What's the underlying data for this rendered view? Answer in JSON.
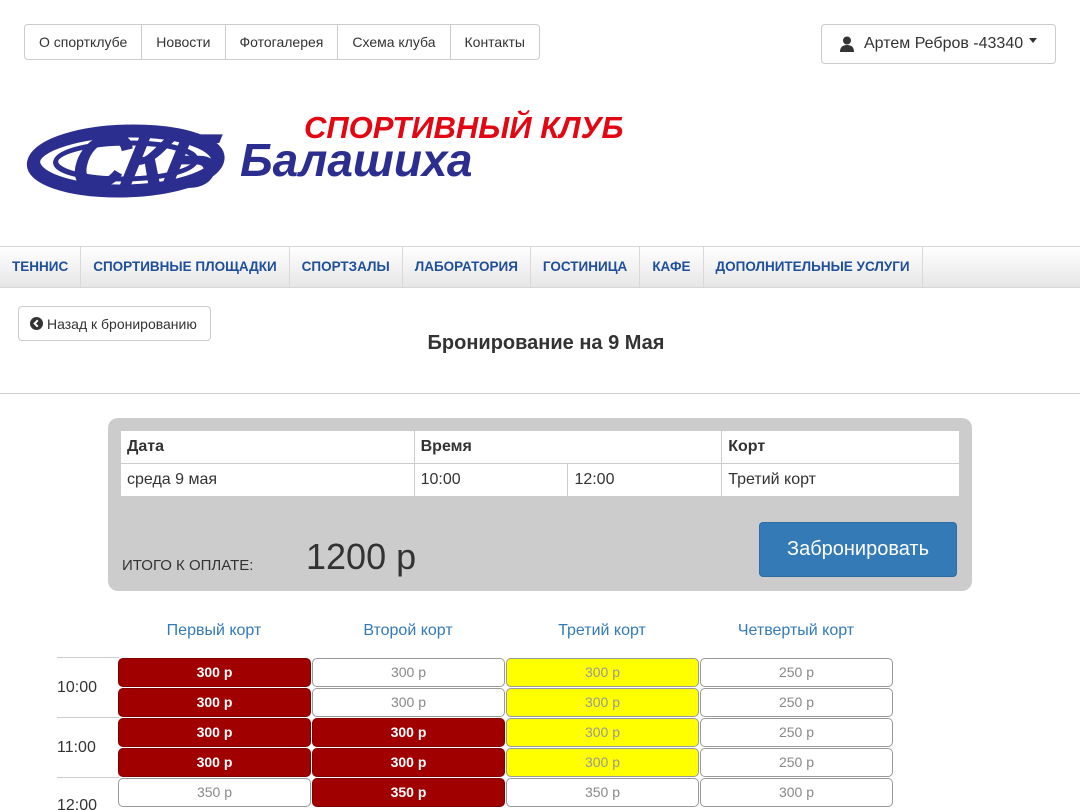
{
  "topnav": [
    "О спортклубе",
    "Новости",
    "Фотогалерея",
    "Схема клуба",
    "Контакты"
  ],
  "user": {
    "name": "Артем Ребров -43340"
  },
  "logo": {
    "line1": "СПОРТИВНЫЙ КЛУБ",
    "line2": "Балашиха",
    "mark": "СКБ"
  },
  "mainnav": [
    "ТЕННИС",
    "СПОРТИВНЫЕ ПЛОЩАДКИ",
    "СПОРТЗАЛЫ",
    "ЛАБОРАТОРИЯ",
    "ГОСТИНИЦА",
    "КАФЕ",
    "ДОПОЛНИТЕЛЬНЫЕ УСЛУГИ"
  ],
  "back_label": "Назад к бронированию",
  "page_title": "Бронирование на 9 Мая",
  "summary": {
    "headers": {
      "date": "Дата",
      "time": "Время",
      "court": "Корт"
    },
    "row": {
      "date": "среда 9 мая",
      "time_from": "10:00",
      "time_to": "12:00",
      "court": "Третий корт"
    },
    "total_label": "ИТОГО К ОПЛАТЕ:",
    "total_value": "1200 р",
    "book_label": "Забронировать"
  },
  "courts": [
    "Первый корт",
    "Второй корт",
    "Третий корт",
    "Четвертый корт"
  ],
  "times": [
    "10:00",
    "11:00",
    "12:00"
  ],
  "slots": [
    [
      {
        "price": "300 р",
        "state": "busy"
      },
      {
        "price": "300 р",
        "state": "free"
      },
      {
        "price": "300 р",
        "state": "selected"
      },
      {
        "price": "250 р",
        "state": "free"
      }
    ],
    [
      {
        "price": "300 р",
        "state": "busy"
      },
      {
        "price": "300 р",
        "state": "free"
      },
      {
        "price": "300 р",
        "state": "selected"
      },
      {
        "price": "250 р",
        "state": "free"
      }
    ],
    [
      {
        "price": "300 р",
        "state": "busy"
      },
      {
        "price": "300 р",
        "state": "busy"
      },
      {
        "price": "300 р",
        "state": "selected"
      },
      {
        "price": "250 р",
        "state": "free"
      }
    ],
    [
      {
        "price": "300 р",
        "state": "busy"
      },
      {
        "price": "300 р",
        "state": "busy"
      },
      {
        "price": "300 р",
        "state": "selected"
      },
      {
        "price": "250 р",
        "state": "free"
      }
    ],
    [
      {
        "price": "350 р",
        "state": "free"
      },
      {
        "price": "350 р",
        "state": "busy"
      },
      {
        "price": "350 р",
        "state": "free"
      },
      {
        "price": "300 р",
        "state": "free"
      }
    ]
  ],
  "colors": {
    "busy": "#a00000",
    "selected": "#ffff00",
    "accent": "#337ab7",
    "nav_text": "#1f4e9a",
    "logo_red": "#e30613",
    "logo_blue": "#2b2e8f"
  }
}
